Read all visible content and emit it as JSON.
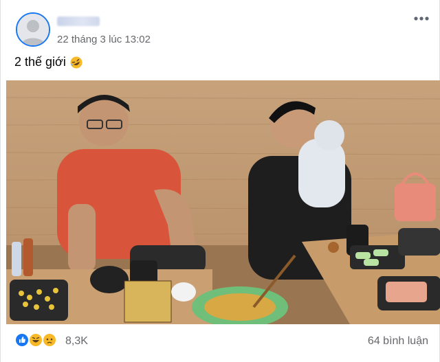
{
  "post": {
    "timestamp": "22 tháng 3 lúc 13:02",
    "caption": "2 thế giới",
    "caption_emoji": "rolling-on-floor-laughing",
    "more_icon": "more-horizontal-icon"
  },
  "photo": {
    "subject": "restaurant-photo"
  },
  "footer": {
    "reactions": [
      "like",
      "haha",
      "sad"
    ],
    "reaction_count": "8,3K",
    "comments": "64 bình luận"
  },
  "colors": {
    "accent": "#1877f2",
    "secondary_text": "#65676b"
  }
}
